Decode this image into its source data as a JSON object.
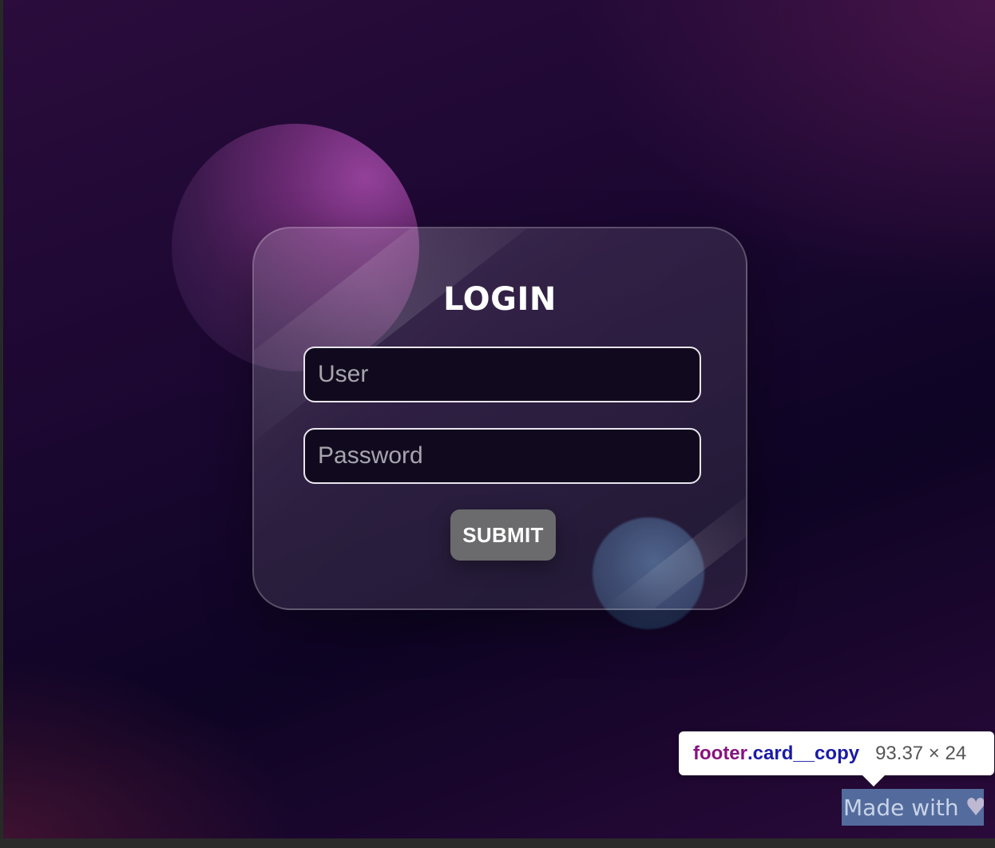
{
  "login": {
    "title": "LOGIN",
    "user_placeholder": "User",
    "password_placeholder": "Password",
    "submit_label": "SUBMIT"
  },
  "devtools_tooltip": {
    "tag": "footer",
    "class_name": ".card__copy",
    "size": "93.37 × 24"
  },
  "footer": {
    "text": "Made with",
    "icon": "heart-icon"
  },
  "colors": {
    "background_dark": "#0e0424",
    "background_purple": "#2b0c3c",
    "orb_magenta": "#93419a",
    "orb_blue": "#3e5580",
    "submit_bg": "#6b6a6c",
    "field_border": "#e8e4ee"
  }
}
